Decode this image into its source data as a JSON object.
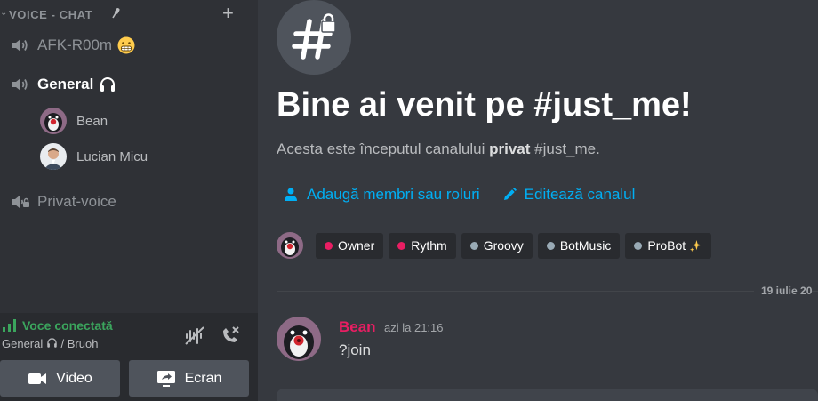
{
  "sidebar": {
    "category": {
      "label": "VOICE - CHAT",
      "icon": "microphone-icon",
      "add_icon": "plus-icon"
    },
    "channels": [
      {
        "name": "AFK-R00m",
        "emoji": "grimacing-face-emoji",
        "icon": "speaker-icon"
      },
      {
        "name": "General",
        "emoji": "headphones-emoji",
        "icon": "speaker-icon",
        "active": true
      },
      {
        "name": "Privat-voice",
        "icon": "speaker-locked-icon"
      }
    ],
    "voice_users": [
      {
        "name": "Bean"
      },
      {
        "name": "Lucian Micu"
      }
    ]
  },
  "voice_panel": {
    "status": "Voce conectată",
    "channel": "General",
    "server": "Bruoh",
    "separator": "/",
    "status_color": "#3ba55d",
    "video_label": "Video",
    "screen_label": "Ecran"
  },
  "main": {
    "welcome": "Bine ai venit pe #just_me!",
    "intro_prefix": "Acesta este începutul canalului ",
    "intro_bold": "privat",
    "intro_suffix": " #just_me.",
    "add_members": "Adaugă membri sau roluri",
    "edit_channel": "Editează canalul",
    "roles": [
      {
        "name": "Owner",
        "color": "#e91e63"
      },
      {
        "name": "Rythm",
        "color": "#e91e63"
      },
      {
        "name": "Groovy",
        "color": "#99aab5"
      },
      {
        "name": "BotMusic",
        "color": "#99aab5"
      },
      {
        "name": "ProBot",
        "color": "#99aab5",
        "emoji": "sparkles-emoji"
      }
    ],
    "date_divider": "19 iulie 20",
    "message": {
      "author": "Bean",
      "author_color": "#e91e63",
      "time": "azi la 21:16",
      "text": "?join"
    }
  },
  "colors": {
    "link": "#00aff4",
    "sidebar_bg": "#2f3136",
    "main_bg": "#36393f"
  }
}
